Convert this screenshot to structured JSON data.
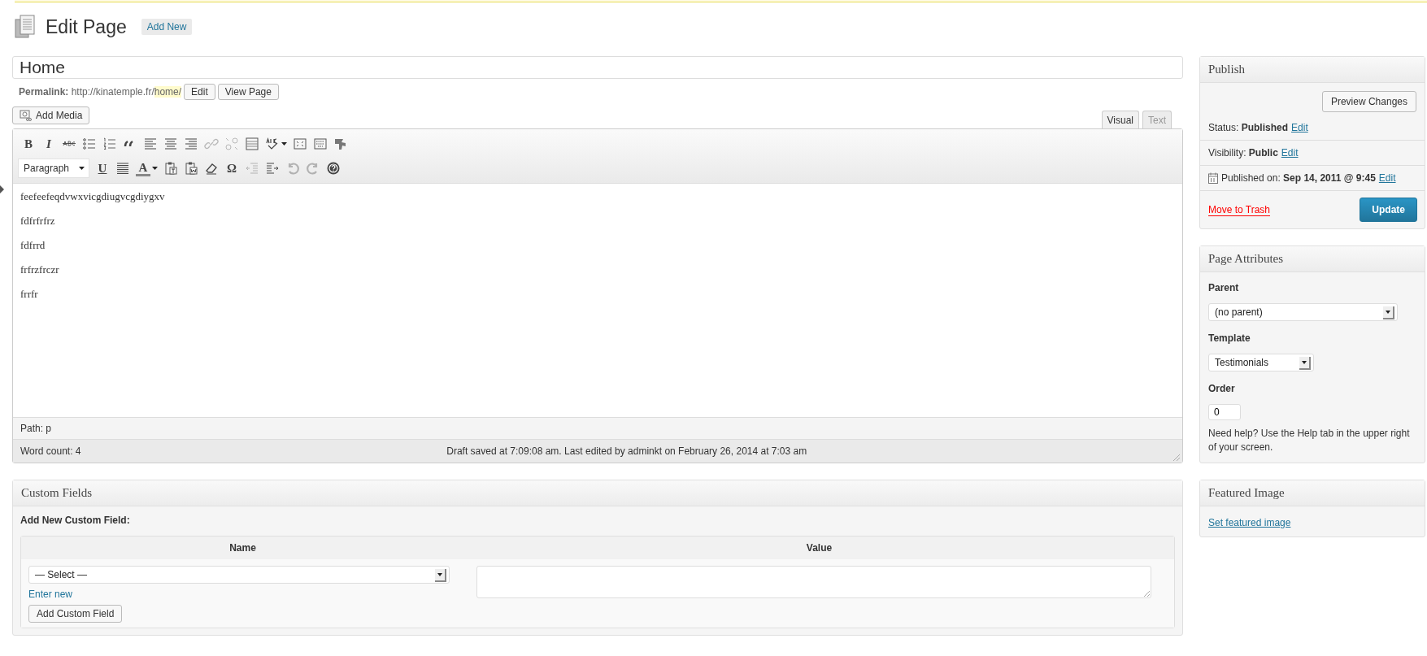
{
  "header": {
    "title": "Edit Page",
    "add_new": "Add New"
  },
  "post_title": {
    "value": "Home"
  },
  "permalink": {
    "label": "Permalink:",
    "url_base": "http://kinatemple.fr/",
    "slug": "home/",
    "buttons": [
      "Edit",
      "View Page"
    ]
  },
  "add_media": "Add Media",
  "editor_tabs": [
    {
      "label": "Visual",
      "selected": true
    },
    {
      "label": "Text",
      "selected": false
    }
  ],
  "toolbar_rows": [
    [
      {
        "kind": "bold",
        "glyph": "B",
        "disabled": false
      },
      {
        "kind": "italic",
        "glyph": "I",
        "disabled": false
      },
      {
        "kind": "strike",
        "disabled": false
      },
      {
        "kind": "bullets",
        "disabled": false
      },
      {
        "kind": "numbers",
        "disabled": false
      },
      {
        "kind": "quote",
        "disabled": false
      },
      {
        "kind": "align-left",
        "disabled": false
      },
      {
        "kind": "align-center",
        "disabled": false
      },
      {
        "kind": "align-right",
        "disabled": false
      },
      {
        "kind": "link",
        "disabled": true
      },
      {
        "kind": "unlink",
        "disabled": true
      },
      {
        "kind": "more",
        "disabled": false
      },
      {
        "kind": "spell",
        "disabled": false
      },
      {
        "kind": "fullscreen",
        "disabled": false
      },
      {
        "kind": "kitchen",
        "disabled": false
      },
      {
        "kind": "plugin",
        "disabled": false
      }
    ],
    [
      {
        "kind": "format",
        "value": "Paragraph"
      },
      {
        "kind": "underline",
        "glyph": "U",
        "disabled": false
      },
      {
        "kind": "justify",
        "disabled": false
      },
      {
        "kind": "color",
        "glyph": "A",
        "disabled": false
      },
      {
        "kind": "paste-text",
        "disabled": false
      },
      {
        "kind": "paste-word",
        "disabled": false
      },
      {
        "kind": "eraser",
        "disabled": false
      },
      {
        "kind": "omega",
        "glyph": "Ω",
        "disabled": false
      },
      {
        "kind": "outdent",
        "disabled": true
      },
      {
        "kind": "indent",
        "disabled": false
      },
      {
        "kind": "undo",
        "disabled": true
      },
      {
        "kind": "redo",
        "disabled": true
      },
      {
        "kind": "help",
        "disabled": false
      }
    ]
  ],
  "content": [
    "feefeefeqdvwxvicgdiugvcgdiygxv",
    "fdfrfrfrz",
    "fdfrrd",
    "frfrzfrczr",
    "frrfr"
  ],
  "path": "Path: p",
  "word_count": "Word count: 4",
  "draft_status": "Draft saved at 7:09:08 am. Last edited by adminkt on February 26, 2014 at 7:03 am",
  "custom_fields": {
    "title": "Custom Fields",
    "subtitle": "Add New Custom Field:",
    "columns": [
      "Name",
      "Value"
    ],
    "select": "— Select —",
    "enter_new": "Enter new",
    "button": "Add Custom Field"
  },
  "publish": {
    "title": "Publish",
    "preview": "Preview Changes",
    "rows": [
      {
        "label": "Status:",
        "value": "Published",
        "link": "Edit"
      },
      {
        "label": "Visibility:",
        "value": "Public",
        "link": "Edit"
      },
      {
        "label": "Published on:",
        "value": "Sep 14, 2011 @ 9:45",
        "link": "Edit"
      }
    ],
    "trash": "Move to Trash",
    "update": "Update"
  },
  "page_attributes": {
    "title": "Page Attributes",
    "parent_label": "Parent",
    "parent": "(no parent)",
    "template_label": "Template",
    "template": "Testimonials",
    "order_label": "Order",
    "order": "0",
    "help": "Need help? Use the Help tab in the upper right of your screen."
  },
  "featured_image": {
    "title": "Featured Image",
    "link": "Set featured image"
  }
}
